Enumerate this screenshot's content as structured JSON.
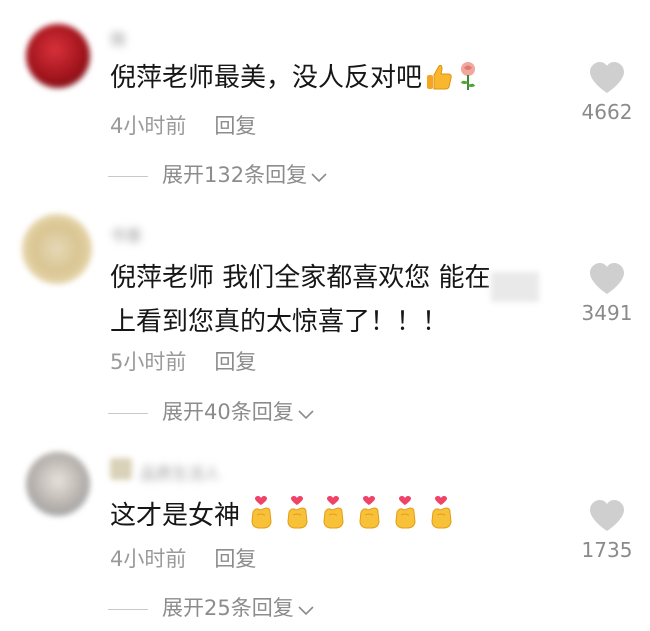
{
  "comments": [
    {
      "username": "微",
      "text": "倪萍老师最美，没人反对吧",
      "time": "4小时前",
      "reply": "回复",
      "expand": "展开132条回复",
      "likes": "4662",
      "emojis": [
        "thumbs-up-icon",
        "rose-icon"
      ]
    },
    {
      "username": "书香",
      "text_part1": "倪萍老师 我们全家都喜欢您 能在",
      "text_part2": "上看到您真的太惊喜了！！！",
      "time": "5小时前",
      "reply": "回复",
      "expand": "展开40条回复",
      "likes": "3491"
    },
    {
      "username": "品质生活人",
      "text": "这才是女神",
      "time": "4小时前",
      "reply": "回复",
      "expand": "展开25条回复",
      "likes": "1735",
      "emoji_count": 6
    }
  ]
}
